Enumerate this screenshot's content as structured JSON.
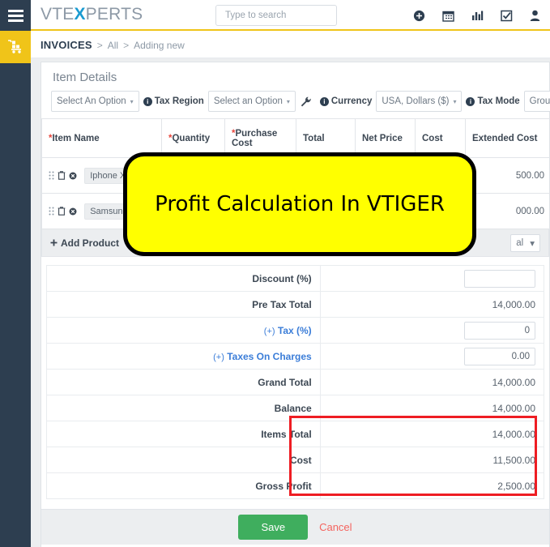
{
  "brand": {
    "logo_prefix": "VTE",
    "logo_accent": "X",
    "logo_suffix": "PERTS",
    "accent_color": "#1b9bd1",
    "rail_color": "#2d3e50",
    "highlight_color": "#f0c419"
  },
  "topbar": {
    "menu_icon": "hamburger-icon",
    "search": {
      "placeholder": "Type to search",
      "value": "",
      "icon": "search-icon",
      "dropdown_icon": "chevron-down-circle-icon"
    },
    "icons": [
      {
        "name": "add-circle-icon",
        "glyph": "add"
      },
      {
        "name": "calendar-icon",
        "glyph": "calendar"
      },
      {
        "name": "analytics-icon",
        "glyph": "bar-chart"
      },
      {
        "name": "tasks-icon",
        "glyph": "checkbox"
      },
      {
        "name": "user-profile-icon",
        "glyph": "user"
      }
    ]
  },
  "sidebar": {
    "items": [
      {
        "name": "inventory-cart-icon",
        "label": "Inventory",
        "active": true
      }
    ]
  },
  "breadcrumb": {
    "module": "INVOICES",
    "separator": ">",
    "view": "All",
    "action": "Adding new"
  },
  "panel": {
    "title": "Item Details",
    "options": {
      "line_item_option": {
        "label": "Select An Option",
        "caret": "▾"
      },
      "tax_region_label": "Tax Region",
      "tax_region_option": {
        "label": "Select an Option",
        "caret": "▾"
      },
      "wrench_icon": "wrench-icon",
      "currency_label": "Currency",
      "currency_option": {
        "label": "USA, Dollars ($)",
        "caret": "▾"
      },
      "tax_mode_label": "Tax Mode",
      "tax_mode_option": {
        "label": "Group",
        "caret": "▾"
      }
    },
    "columns": [
      {
        "label": "Item Name",
        "required": true
      },
      {
        "label": "Quantity",
        "required": true
      },
      {
        "label": "Purchase Cost",
        "required": true
      },
      {
        "label": "Total",
        "required": false
      },
      {
        "label": "Net Price",
        "required": false
      },
      {
        "label": "Cost",
        "required": false
      },
      {
        "label": "Extended Cost",
        "required": false
      }
    ],
    "rows": [
      {
        "handle_icon": "drag-handle-icon",
        "delete_icon": "trash-icon",
        "clear_icon": "clear-circle-icon",
        "item_name": "Iphone X",
        "extended_cost": "500.00"
      },
      {
        "handle_icon": "drag-handle-icon",
        "delete_icon": "trash-icon",
        "clear_icon": "clear-circle-icon",
        "item_name": "Samsung",
        "extended_cost": "000.00"
      }
    ],
    "add_product_label": "Add Product",
    "add_product_icon": "plus-icon",
    "final_select": {
      "label": "al",
      "caret": "▾"
    }
  },
  "totals": {
    "rows": [
      {
        "label": "Discount (%)",
        "link": false,
        "type": "input",
        "value": ""
      },
      {
        "label": "Pre Tax Total",
        "link": false,
        "type": "text",
        "value": "14,000.00"
      },
      {
        "label": "Tax (%)",
        "prefix": "(+)",
        "link": true,
        "type": "input",
        "value": "0"
      },
      {
        "label": "Taxes On Charges",
        "prefix": "(+)",
        "link": true,
        "type": "input",
        "value": "0.00"
      },
      {
        "label": "Grand Total",
        "link": false,
        "type": "text",
        "value": "14,000.00"
      },
      {
        "label": "Balance",
        "link": false,
        "type": "text",
        "value": "14,000.00"
      },
      {
        "label": "Items Total",
        "link": false,
        "type": "text",
        "value": "14,000.00",
        "highlighted": true
      },
      {
        "label": "Cost",
        "link": false,
        "type": "text",
        "value": "11,500.00",
        "highlighted": true
      },
      {
        "label": "Gross Profit",
        "link": false,
        "type": "text",
        "value": "2,500.00",
        "highlighted": true
      }
    ],
    "highlight_color": "#ee1d23"
  },
  "footer": {
    "save_label": "Save",
    "cancel_label": "Cancel",
    "save_color": "#3fae5e",
    "cancel_color": "#f4645f"
  },
  "banner": {
    "text": "Profit Calculation In VTIGER",
    "background": "#ffff00",
    "border": "#000000"
  }
}
